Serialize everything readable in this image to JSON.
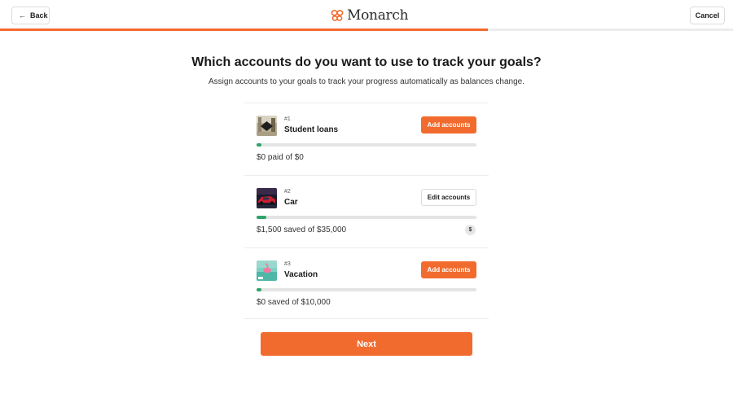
{
  "header": {
    "back_label": "Back",
    "back_icon": "arrow-left-icon",
    "logo_text": "Monarch",
    "logo_icon": "butterfly-icon",
    "cancel_label": "Cancel"
  },
  "colors": {
    "accent": "#f26b2e",
    "progress_green": "#2ea36f"
  },
  "page": {
    "title": "Which accounts do you want to use to track your goals?",
    "subtitle": "Assign accounts to your goals to track your progress automatically as balances change."
  },
  "goals": [
    {
      "rank": "#1",
      "name": "Student loans",
      "action_label": "Add accounts",
      "amount_text": "$0 paid of $0",
      "progress_fraction": 0.02
    },
    {
      "rank": "#2",
      "name": "Car",
      "action_label": "Edit accounts",
      "amount_text": "$1,500 saved of $35,000",
      "badge": "$",
      "progress_fraction": 0.043
    },
    {
      "rank": "#3",
      "name": "Vacation",
      "action_label": "Add accounts",
      "amount_text": "$0 saved of $10,000",
      "progress_fraction": 0.02
    }
  ],
  "footer": {
    "next_label": "Next"
  },
  "step_progress_fraction": 0.666
}
